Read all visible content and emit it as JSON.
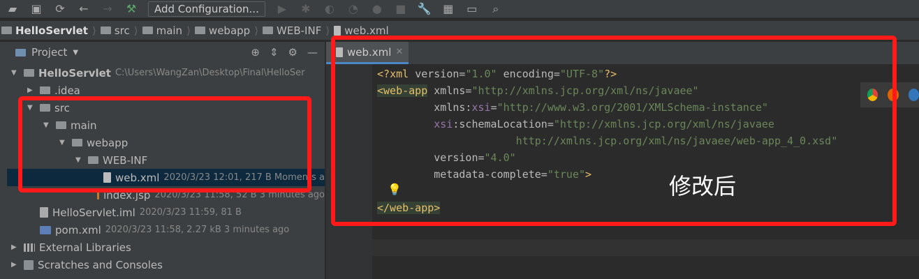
{
  "toolbar": {
    "add_configuration": "Add Configuration..."
  },
  "breadcrumb": [
    "HelloServlet",
    "src",
    "main",
    "webapp",
    "WEB-INF",
    "web.xml"
  ],
  "project": {
    "title": "Project",
    "rows": [
      {
        "label": "HelloServlet",
        "meta": "C:\\Users\\WangZan\\Desktop\\Final\\HelloSer",
        "depth": 0,
        "arrow": "down",
        "icon": "module"
      },
      {
        "label": ".idea",
        "meta": "",
        "depth": 1,
        "arrow": "right",
        "icon": "folder"
      },
      {
        "label": "src",
        "meta": "",
        "depth": 1,
        "arrow": "down",
        "icon": "folder"
      },
      {
        "label": "main",
        "meta": "",
        "depth": 2,
        "arrow": "down",
        "icon": "folder"
      },
      {
        "label": "webapp",
        "meta": "",
        "depth": 3,
        "arrow": "down",
        "icon": "folder"
      },
      {
        "label": "WEB-INF",
        "meta": "",
        "depth": 4,
        "arrow": "down",
        "icon": "folder"
      },
      {
        "label": "web.xml",
        "meta": "2020/3/23 12:01, 217 B Moments a",
        "depth": 5,
        "arrow": "",
        "icon": "xml",
        "selected": true
      },
      {
        "label": "index.jsp",
        "meta": "2020/3/23 11:58, 52 B 3 minutes ago",
        "depth": 5,
        "arrow": "",
        "icon": "jsp"
      },
      {
        "label": "HelloServlet.iml",
        "meta": "2020/3/23 11:59, 81 B",
        "depth": 1,
        "arrow": "",
        "icon": "iml"
      },
      {
        "label": "pom.xml",
        "meta": "2020/3/23 11:58, 2.27 kB 3 minutes ago",
        "depth": 1,
        "arrow": "",
        "icon": "maven"
      },
      {
        "label": "External Libraries",
        "meta": "",
        "depth": 0,
        "arrow": "right",
        "icon": "libraries"
      },
      {
        "label": "Scratches and Consoles",
        "meta": "",
        "depth": 0,
        "arrow": "right",
        "icon": "scratches"
      }
    ]
  },
  "editor": {
    "tab": "web.xml",
    "lines": [
      [
        [
          "p",
          "<?"
        ],
        [
          "t",
          "xml "
        ],
        [
          "a",
          "version="
        ],
        [
          "v",
          "\"1.0\""
        ],
        [
          "a",
          " encoding="
        ],
        [
          "v",
          "\"UTF-8\""
        ],
        [
          "p",
          "?>"
        ]
      ],
      [
        [
          "t hl",
          "<web-app"
        ],
        [
          "a",
          " xmlns="
        ],
        [
          "v",
          "\"http://xmlns.jcp.org/xml/ns/javaee\""
        ]
      ],
      [
        [
          "a",
          "         xmlns:"
        ],
        [
          "ns",
          "xsi"
        ],
        [
          "a",
          "="
        ],
        [
          "v",
          "\"http://www.w3.org/2001/XMLSchema-instance\""
        ]
      ],
      [
        [
          "ns",
          "         xsi"
        ],
        [
          "a",
          ":schemaLocation="
        ],
        [
          "v",
          "\"http://xmlns.jcp.org/xml/ns/javaee"
        ]
      ],
      [
        [
          "v",
          "                      http://xmlns.jcp.org/xml/ns/javaee/web-app_4_0.xsd\""
        ]
      ],
      [
        [
          "a",
          "         version="
        ],
        [
          "v",
          "\"4.0\""
        ]
      ],
      [
        [
          "a",
          "         metadata-complete="
        ],
        [
          "v",
          "\"true\""
        ],
        [
          "t",
          ">"
        ]
      ],
      [],
      [
        [
          "t hl",
          "</web-app>"
        ]
      ]
    ]
  },
  "annotation": "修改后"
}
